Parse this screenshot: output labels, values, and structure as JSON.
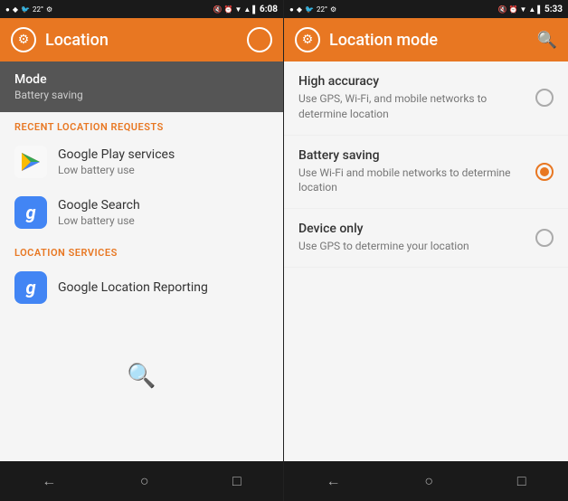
{
  "screen1": {
    "status": {
      "time": "6:08",
      "icons_left": [
        "●",
        "♦",
        "🐦",
        "22°",
        "⚙"
      ],
      "icons_right": [
        "🔇",
        "⏰",
        "▼",
        "📶",
        "🔋"
      ]
    },
    "appbar": {
      "title": "Location",
      "gear_label": "⚙",
      "circle_label": "○"
    },
    "mode_row": {
      "title": "Mode",
      "subtitle": "Battery saving"
    },
    "section1": {
      "header": "RECENT LOCATION REQUESTS",
      "items": [
        {
          "icon_type": "play",
          "title": "Google Play services",
          "subtitle": "Low battery use"
        },
        {
          "icon_type": "google",
          "title": "Google Search",
          "subtitle": "Low battery use"
        }
      ]
    },
    "section2": {
      "header": "LOCATION SERVICES",
      "items": [
        {
          "icon_type": "google",
          "title": "Google Location Reporting",
          "subtitle": ""
        }
      ]
    },
    "nav": {
      "back": "←",
      "home": "○",
      "recents": "□"
    }
  },
  "screen2": {
    "status": {
      "time": "5:33"
    },
    "appbar": {
      "title": "Location mode",
      "gear_label": "⚙",
      "search_label": "🔍"
    },
    "options": [
      {
        "title": "High accuracy",
        "subtitle": "Use GPS, Wi-Fi, and mobile networks to determine location",
        "selected": false
      },
      {
        "title": "Battery saving",
        "subtitle": "Use Wi-Fi and mobile networks to determine location",
        "selected": true
      },
      {
        "title": "Device only",
        "subtitle": "Use GPS to determine your location",
        "selected": false
      }
    ],
    "nav": {
      "back": "←",
      "home": "○",
      "recents": "□"
    }
  }
}
